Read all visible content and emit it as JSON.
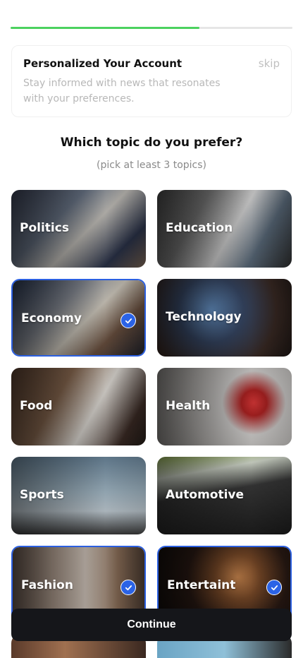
{
  "progress": {
    "fraction": 0.67,
    "color": "#4cd25f"
  },
  "info_card": {
    "title": "Personalized Your Account",
    "description": "Stay informed with news that resonates with your preferences.",
    "skip_label": "skip"
  },
  "question": "Which topic do you prefer?",
  "subtitle": "(pick at least 3 topics)",
  "topics": [
    {
      "label": "Politics",
      "selected": false
    },
    {
      "label": "Education",
      "selected": false
    },
    {
      "label": "Economy",
      "selected": true
    },
    {
      "label": "Technology",
      "selected": false
    },
    {
      "label": "Food",
      "selected": false
    },
    {
      "label": "Health",
      "selected": false
    },
    {
      "label": "Sports",
      "selected": false
    },
    {
      "label": "Automotive",
      "selected": false
    },
    {
      "label": "Fashion",
      "selected": true
    },
    {
      "label": "Entertaint",
      "selected": true
    }
  ],
  "continue_label": "Continue",
  "colors": {
    "accent": "#2b63e6",
    "button": "#15161a"
  }
}
